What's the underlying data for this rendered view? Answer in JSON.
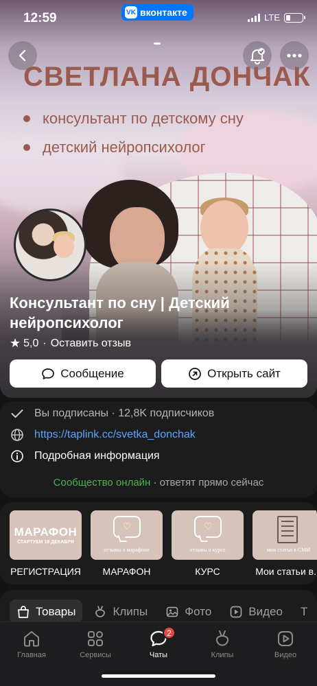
{
  "status": {
    "time": "12:59",
    "app_pill": "вконтакте",
    "network": "LTE",
    "battery_level": 0.25
  },
  "cover": {
    "title": "СВЕТЛАНА ДОНЧАК",
    "bullets": [
      "консультант по детскому сну",
      "детский нейропсихолог"
    ]
  },
  "header": {
    "back_icon": "chevron-left-icon",
    "bell_icon": "bell-check-icon",
    "more_icon": "more-horizontal-icon"
  },
  "community": {
    "name": "Консультант по сну | Детский нейропсихолог",
    "rating": "5,0",
    "review_label": "Оставить отзыв",
    "message_button": "Сообщение",
    "site_button": "Открыть сайт"
  },
  "info": {
    "subscribed": "Вы подписаны · 12,8K подписчиков",
    "link": "https://taplink.cc/svetka_donchak",
    "more_info": "Подробная информация",
    "online_status": "Сообщество онлайн",
    "online_note": " · ответят прямо сейчас"
  },
  "menu": [
    {
      "caption": "РЕГИСТРАЦИЯ",
      "image_title": "МАРАФОН",
      "image_sub": "СТАРТУЕМ 18 ДЕКАБРЯ"
    },
    {
      "caption": "МАРАФОН",
      "image_text": "отзывы о марафоне"
    },
    {
      "caption": "КУРС",
      "image_text": "отзывы о курсе"
    },
    {
      "caption": "Мои статьи в...",
      "image_text": "мои статьи в СМИ"
    }
  ],
  "tabs": [
    {
      "label": "Товары",
      "icon": "bag-icon",
      "active": true
    },
    {
      "label": "Клипы",
      "icon": "clips-icon",
      "active": false
    },
    {
      "label": "Фото",
      "icon": "image-icon",
      "active": false
    },
    {
      "label": "Видео",
      "icon": "video-icon",
      "active": false
    },
    {
      "label": "Т",
      "icon": "text-icon",
      "active": false
    }
  ],
  "nav": [
    {
      "label": "Главная",
      "icon": "home-icon"
    },
    {
      "label": "Сервисы",
      "icon": "services-icon"
    },
    {
      "label": "Чаты",
      "icon": "chat-icon",
      "badge": "2",
      "active": true
    },
    {
      "label": "Клипы",
      "icon": "clips-icon"
    },
    {
      "label": "Видео",
      "icon": "video-icon"
    }
  ],
  "colors": {
    "vk_blue": "#0077ff",
    "link": "#5aa6ff",
    "online_green": "#4bb34b",
    "cover_text": "#9b5a4e",
    "badge_red": "#e64646"
  }
}
